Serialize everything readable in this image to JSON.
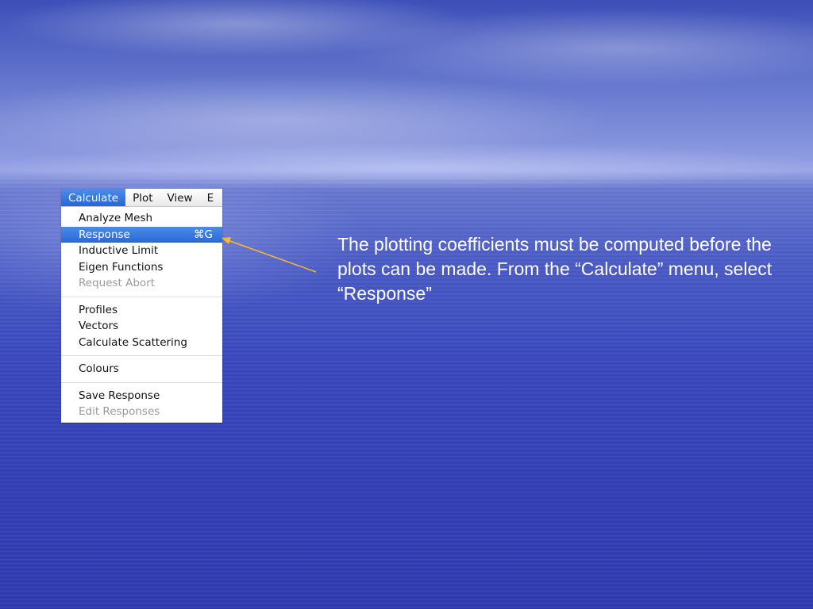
{
  "menubar": {
    "titles": [
      {
        "label": "Calculate"
      },
      {
        "label": "Plot"
      },
      {
        "label": "View"
      },
      {
        "label": "E"
      }
    ]
  },
  "menu": {
    "groups": [
      [
        {
          "label": "Analyze Mesh",
          "shortcut": ""
        },
        {
          "label": "Response",
          "shortcut": "⌘G"
        },
        {
          "label": "Inductive Limit",
          "shortcut": ""
        },
        {
          "label": "Eigen Functions",
          "shortcut": ""
        },
        {
          "label": "Request Abort",
          "shortcut": ""
        }
      ],
      [
        {
          "label": "Profiles",
          "shortcut": ""
        },
        {
          "label": "Vectors",
          "shortcut": ""
        },
        {
          "label": "Calculate Scattering",
          "shortcut": ""
        }
      ],
      [
        {
          "label": "Colours",
          "shortcut": ""
        }
      ],
      [
        {
          "label": "Save Response",
          "shortcut": ""
        },
        {
          "label": "Edit Responses",
          "shortcut": ""
        }
      ]
    ]
  },
  "caption": {
    "text": "The plotting coefficients must be computed before the plots can be made.  From the “Calculate” menu, select “Response”"
  },
  "colors": {
    "arrow": "#f5b82e",
    "highlight": "#2a69d8",
    "caption_text": "#ffffff"
  }
}
